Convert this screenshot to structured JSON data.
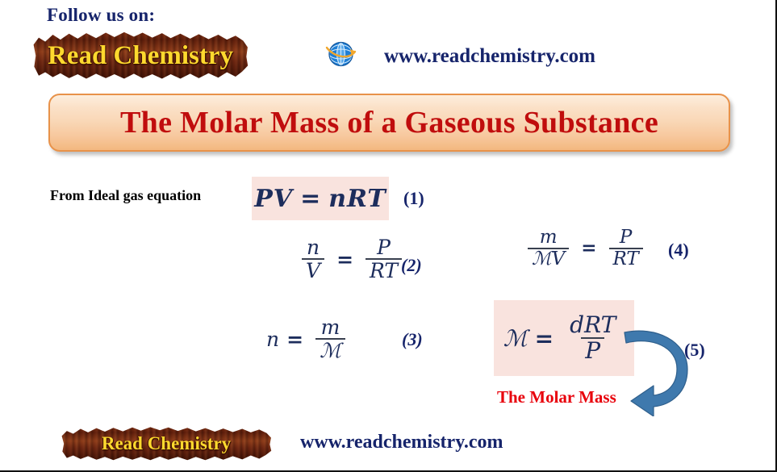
{
  "header": {
    "follow_label": "Follow us on:",
    "brand_logo_text": "Read Chemistry",
    "website_url": "www.readchemistry.com",
    "globe_icon": "globe-icon"
  },
  "title": {
    "text": "The Molar Mass of  a Gaseous Substance"
  },
  "body": {
    "lead_label": "From Ideal gas equation",
    "molar_mass_label": "The Molar Mass",
    "arrow_icon": "curved-arrow-icon",
    "equations": [
      {
        "number": "(1)",
        "plain": "PV = nRT",
        "lhs_a": "PV",
        "eqsign": "=",
        "rhs_a": "nRT",
        "boxed": true
      },
      {
        "number": "(2)",
        "plain": "n/V = P/RT",
        "lhs_num": "n",
        "lhs_den": "V",
        "eqsign": "=",
        "rhs_num": "P",
        "rhs_den": "RT",
        "boxed": false
      },
      {
        "number": "(3)",
        "plain": "n = m/M",
        "lhs_a": "n",
        "eqsign": "=",
        "rhs_num": "m",
        "rhs_den": "ℳ",
        "boxed": false
      },
      {
        "number": "(4)",
        "plain": "m/(MV) = P/RT",
        "lhs_num": "m",
        "lhs_den": "ℳV",
        "eqsign": "=",
        "rhs_num": "P",
        "rhs_den": "RT",
        "boxed": false
      },
      {
        "number": "(5)",
        "plain": "M = dRT/P",
        "lhs_a": "ℳ",
        "eqsign": "=",
        "rhs_num": "dRT",
        "rhs_den": "P",
        "boxed": true
      }
    ]
  },
  "footer": {
    "brand_logo_text": "Read Chemistry",
    "website_url": "www.readchemistry.com"
  },
  "colors": {
    "navy": "#16246b",
    "title_red": "#c00d0d",
    "accent_red": "#e8000b",
    "banner_border": "#e8924a",
    "pink_box": "#f9e3de",
    "arrow_blue": "#3f79ad",
    "wood_brown": "#6a2410",
    "logo_yellow": "#ffd92e"
  }
}
